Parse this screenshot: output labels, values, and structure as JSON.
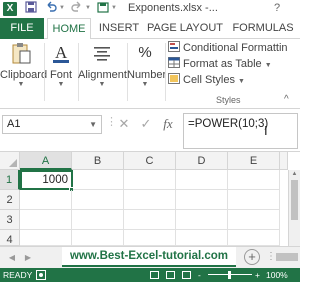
{
  "window": {
    "title": "Exponents.xlsx -...",
    "app_icon": "X",
    "help": "?"
  },
  "quick_access": {
    "save_icon": "save-icon",
    "undo_icon": "undo-icon",
    "redo_icon": "redo-icon"
  },
  "ribbon_tabs": [
    "FILE",
    "HOME",
    "INSERT",
    "PAGE LAYOUT",
    "FORMULAS"
  ],
  "ribbon": {
    "clipboard": "Clipboard",
    "font": "Font",
    "alignment": "Alignment",
    "number": "Number",
    "number_icon": "%",
    "conditional_formatting": "Conditional Formattin",
    "format_as_table": "Format as Table",
    "cell_styles": "Cell Styles",
    "styles_group": "Styles"
  },
  "formula_bar": {
    "name_box": "A1",
    "cancel_icon": "✕",
    "enter_icon": "✓",
    "fx_icon": "fx",
    "formula": "=POWER(10;3)"
  },
  "grid": {
    "columns": [
      "A",
      "B",
      "C",
      "D",
      "E"
    ],
    "rows": [
      "1",
      "2",
      "3",
      "4"
    ],
    "cells": {
      "A1": "1000"
    },
    "active_cell": "A1"
  },
  "sheet_tab": "www.Best-Excel-tutorial.com",
  "status_bar": {
    "ready": "READY",
    "zoom_minus": "-",
    "zoom_plus": "+",
    "zoom": "100%"
  },
  "colors": {
    "accent": "#217346",
    "ribbon_text": "#444444",
    "grid_line": "#e1e1e1",
    "header_bg": "#f3f3f3"
  }
}
